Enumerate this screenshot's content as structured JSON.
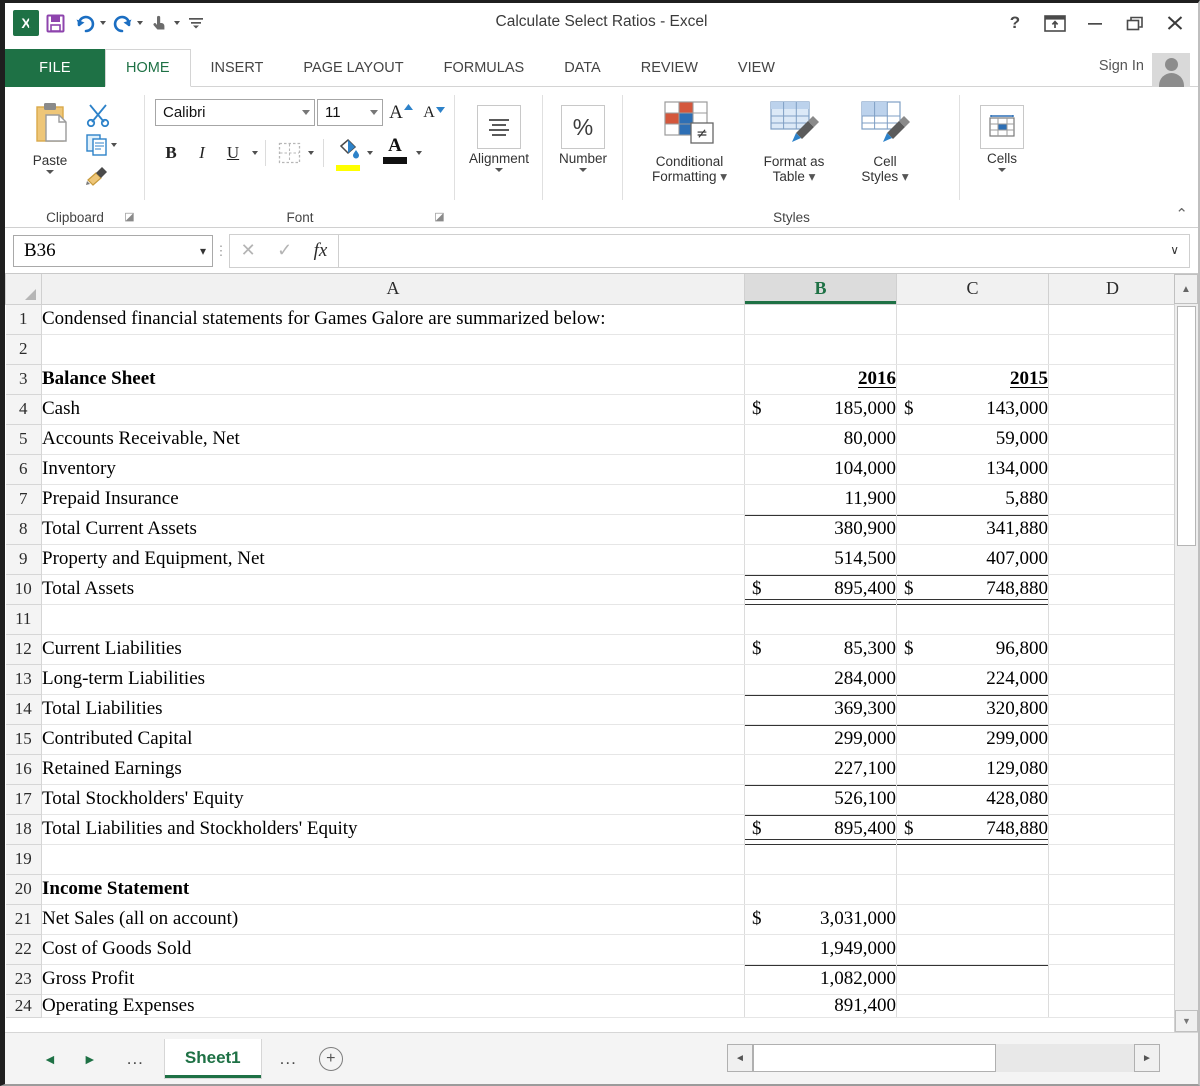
{
  "window": {
    "title": "Calculate Select Ratios - Excel",
    "help_label": "?",
    "ribbon_display_label": "↑",
    "minimize_label": "–",
    "restore_label": "❐",
    "close_label": "✕",
    "signin_label": "Sign In"
  },
  "quick_access": {
    "save_label": "⬛",
    "undo_label": "↶",
    "redo_label": "↷",
    "touch_label": "☝",
    "customize_label": "≡"
  },
  "ribbon": {
    "tabs": [
      {
        "label": "FILE"
      },
      {
        "label": "HOME"
      },
      {
        "label": "INSERT"
      },
      {
        "label": "PAGE LAYOUT"
      },
      {
        "label": "FORMULAS"
      },
      {
        "label": "DATA"
      },
      {
        "label": "REVIEW"
      },
      {
        "label": "VIEW"
      }
    ],
    "active_tab": "HOME",
    "collapse_label": "⌃",
    "groups": {
      "clipboard": {
        "label": "Clipboard",
        "paste_label": "Paste",
        "cut_label": "cut",
        "copy_label": "copy",
        "format_painter_label": "format-painter"
      },
      "font": {
        "label": "Font",
        "font_name": "Calibri",
        "font_size": "11",
        "grow_font_label": "A",
        "shrink_font_label": "A",
        "bold_label": "B",
        "italic_label": "I",
        "underline_label": "U",
        "borders_label": "borders",
        "fill_color_label": "A",
        "font_color_label": "A"
      },
      "alignment": {
        "label": "Alignment"
      },
      "number": {
        "label": "Number",
        "icon_label": "%"
      },
      "styles": {
        "label": "Styles",
        "conditional_formatting_label": "Conditional\nFormatting",
        "conditional_formatting_line1": "Conditional",
        "conditional_formatting_line2": "Formatting",
        "format_as_table_line1": "Format as",
        "format_as_table_line2": "Table",
        "cell_styles_line1": "Cell",
        "cell_styles_line2": "Styles"
      },
      "cells": {
        "label": "Cells"
      }
    }
  },
  "formula_bar": {
    "name_box_value": "B36",
    "cancel_label": "✕",
    "enter_label": "✓",
    "function_label": "fx",
    "formula_value": "",
    "expand_label": "∨"
  },
  "grid": {
    "columns": [
      "A",
      "B",
      "C",
      "D"
    ],
    "selected_column": "B",
    "selected_cell": "B36",
    "rows": [
      {
        "n": "1",
        "a": "Condensed financial statements for Games Galore are summarized below:",
        "a_bold": false,
        "a_indent": false,
        "b": "",
        "c": ""
      },
      {
        "n": "2",
        "a": "",
        "a_bold": false,
        "a_indent": false,
        "b": "",
        "c": ""
      },
      {
        "n": "3",
        "a": "Balance Sheet",
        "a_bold": true,
        "a_indent": false,
        "b": "2016",
        "c": "2015",
        "style": "year"
      },
      {
        "n": "4",
        "a": "Cash",
        "a_bold": false,
        "a_indent": false,
        "b": "185,000",
        "c": "143,000",
        "b_dollar": "$",
        "c_dollar": "$"
      },
      {
        "n": "5",
        "a": "Accounts Receivable, Net",
        "a_bold": false,
        "a_indent": false,
        "b": "80,000",
        "c": "59,000"
      },
      {
        "n": "6",
        "a": "Inventory",
        "a_bold": false,
        "a_indent": false,
        "b": "104,000",
        "c": "134,000"
      },
      {
        "n": "7",
        "a": "Prepaid Insurance",
        "a_bold": false,
        "a_indent": false,
        "b": "11,900",
        "c": "5,880"
      },
      {
        "n": "8",
        "a": "Total Current Assets",
        "a_bold": false,
        "a_indent": true,
        "b": "380,900",
        "c": "341,880",
        "style": "subtotal"
      },
      {
        "n": "9",
        "a": "Property and Equipment, Net",
        "a_bold": false,
        "a_indent": false,
        "b": "514,500",
        "c": "407,000"
      },
      {
        "n": "10",
        "a": "Total Assets",
        "a_bold": false,
        "a_indent": true,
        "b": "895,400",
        "c": "748,880",
        "b_dollar": "$",
        "c_dollar": "$",
        "style": "grandtotal"
      },
      {
        "n": "11",
        "a": "",
        "a_bold": false,
        "a_indent": false,
        "b": "",
        "c": ""
      },
      {
        "n": "12",
        "a": "Current Liabilities",
        "a_bold": false,
        "a_indent": false,
        "b": "85,300",
        "c": "96,800",
        "b_dollar": "$",
        "c_dollar": "$"
      },
      {
        "n": "13",
        "a": "Long-term Liabilities",
        "a_bold": false,
        "a_indent": false,
        "b": "284,000",
        "c": "224,000"
      },
      {
        "n": "14",
        "a": "Total Liabilities",
        "a_bold": false,
        "a_indent": true,
        "b": "369,300",
        "c": "320,800",
        "style": "subtotal"
      },
      {
        "n": "15",
        "a": "Contributed Capital",
        "a_bold": false,
        "a_indent": false,
        "b": "299,000",
        "c": "299,000",
        "style": "subtotal"
      },
      {
        "n": "16",
        "a": "Retained Earnings",
        "a_bold": false,
        "a_indent": false,
        "b": "227,100",
        "c": "129,080"
      },
      {
        "n": "17",
        "a": "Total Stockholders' Equity",
        "a_bold": false,
        "a_indent": true,
        "b": "526,100",
        "c": "428,080",
        "style": "subtotal"
      },
      {
        "n": "18",
        "a": "Total Liabilities and Stockholders' Equity",
        "a_bold": false,
        "a_indent": true,
        "b": "895,400",
        "c": "748,880",
        "b_dollar": "$",
        "c_dollar": "$",
        "style": "grandtotal"
      },
      {
        "n": "19",
        "a": "",
        "a_bold": false,
        "a_indent": false,
        "b": "",
        "c": ""
      },
      {
        "n": "20",
        "a": "Income Statement",
        "a_bold": true,
        "a_indent": false,
        "b": "",
        "c": ""
      },
      {
        "n": "21",
        "a": "Net Sales (all on account)",
        "a_bold": false,
        "a_indent": false,
        "b": "3,031,000",
        "c": "",
        "b_dollar": "$"
      },
      {
        "n": "22",
        "a": "Cost of Goods Sold",
        "a_bold": false,
        "a_indent": false,
        "b": "1,949,000",
        "c": ""
      },
      {
        "n": "23",
        "a": "Gross Profit",
        "a_bold": false,
        "a_indent": false,
        "b": "1,082,000",
        "c": "",
        "style": "subtotal"
      },
      {
        "n": "24",
        "a": "Operating Expenses",
        "a_bold": false,
        "a_indent": false,
        "b": "891,400",
        "c": "",
        "clipped": true
      }
    ]
  },
  "sheet_bar": {
    "first_label": "◄",
    "next_label": "►",
    "left_dots": "...",
    "right_dots": "...",
    "active_sheet": "Sheet1",
    "new_sheet_label": "+"
  },
  "scrollbars": {
    "v_up_label": "▲",
    "v_down_label": "▼",
    "h_left_label": "◄",
    "h_right_label": "►"
  }
}
